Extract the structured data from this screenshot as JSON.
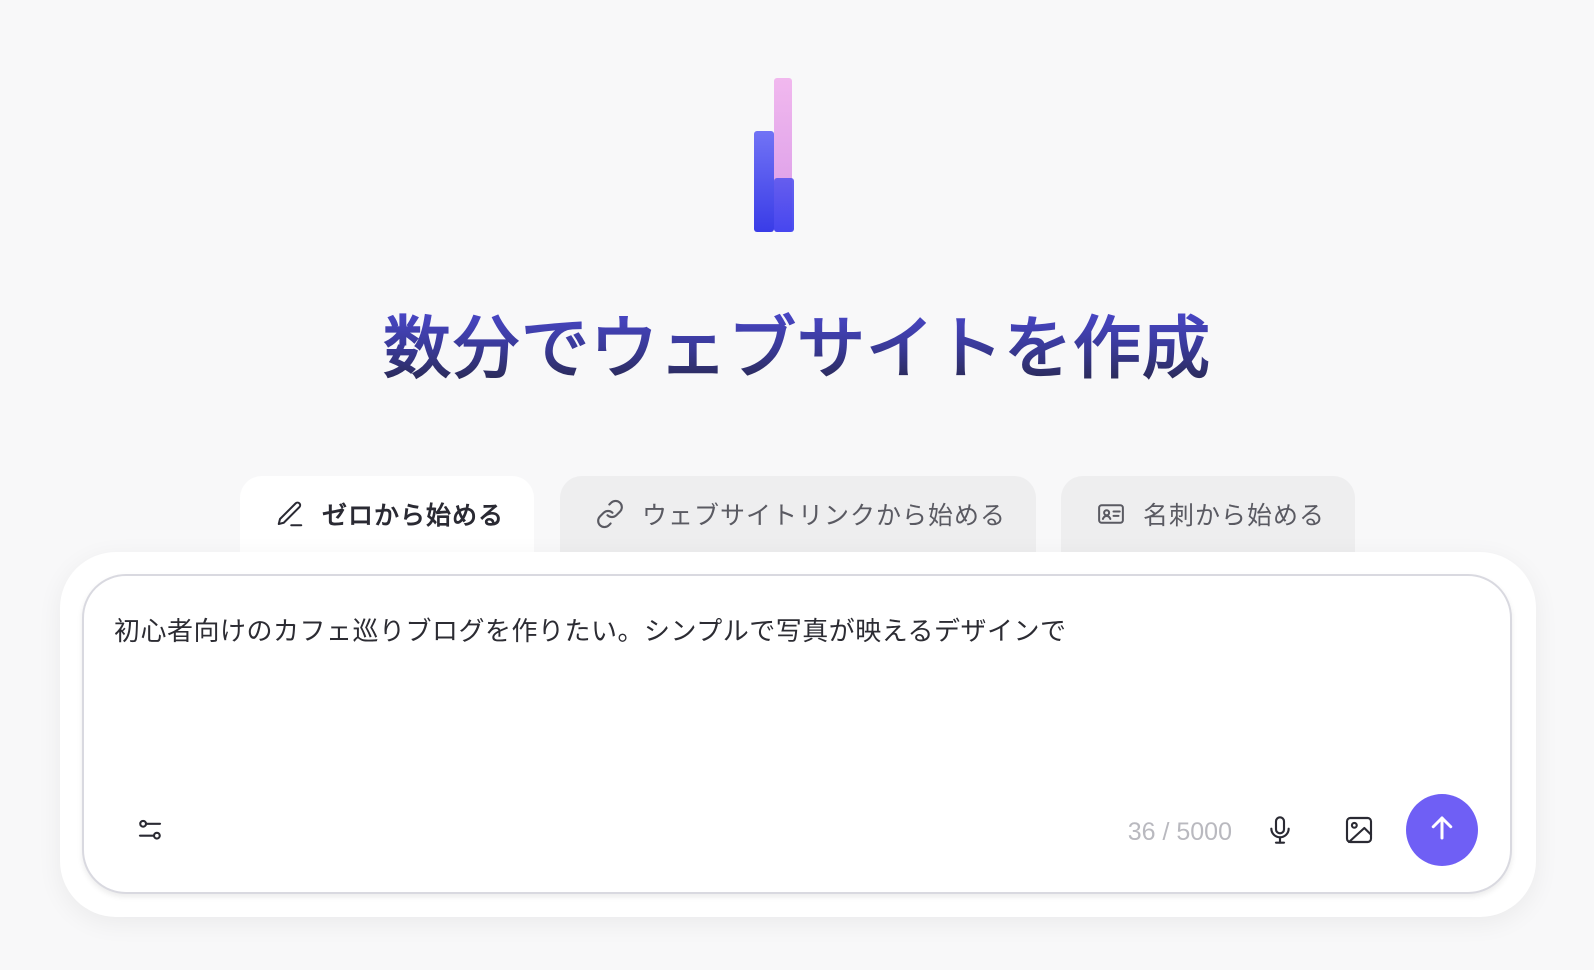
{
  "hero": {
    "title": "数分でウェブサイトを作成"
  },
  "tabs": [
    {
      "label": "ゼロから始める",
      "icon": "pencil-icon",
      "active": true
    },
    {
      "label": "ウェブサイトリンクから始める",
      "icon": "link-icon",
      "active": false
    },
    {
      "label": "名刺から始める",
      "icon": "id-card-icon",
      "active": false
    }
  ],
  "composer": {
    "prompt_text": "初心者向けのカフェ巡りブログを作りたい。シンプルで写真が映えるデザインで",
    "char_count": "36 / 5000",
    "settings_icon": "sliders-icon",
    "mic_icon": "microphone-icon",
    "image_icon": "image-icon",
    "send_icon": "arrow-up-icon"
  },
  "colors": {
    "accent": "#6f5ff5",
    "title_top": "#4a47c9",
    "title_bottom": "#262645",
    "logo_blue": "#3b3ff0",
    "logo_pink": "#e6a4e6"
  }
}
